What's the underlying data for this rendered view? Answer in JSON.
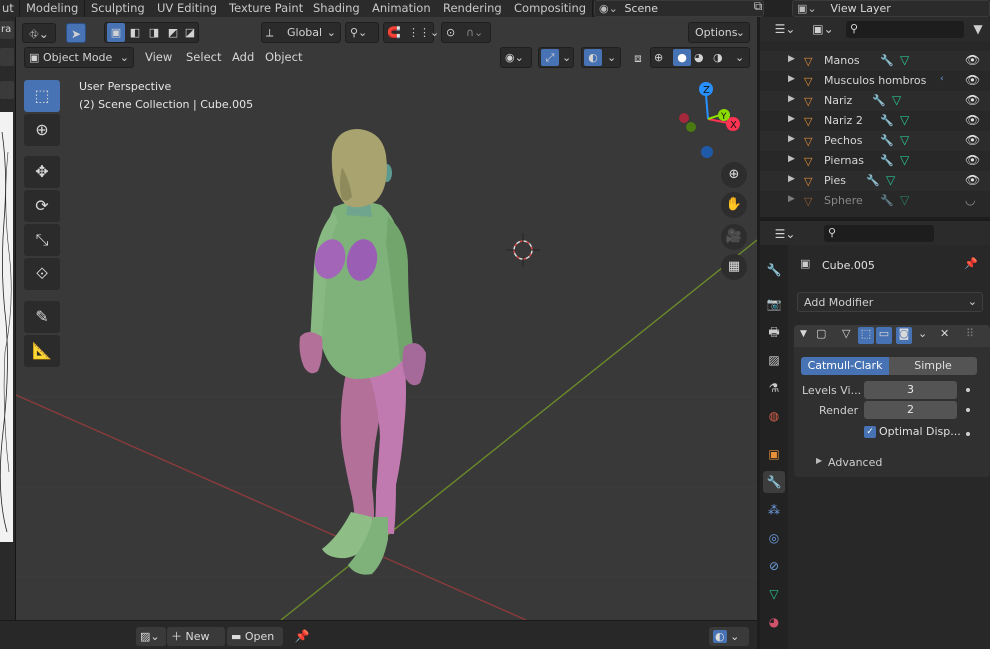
{
  "workspace_tabs": [
    {
      "label": "ut",
      "active": false
    },
    {
      "label": "Modeling",
      "active": false
    },
    {
      "label": "Sculpting",
      "active": false
    },
    {
      "label": "UV Editing",
      "active": false
    },
    {
      "label": "Texture Paint",
      "active": false
    },
    {
      "label": "Shading",
      "active": false
    },
    {
      "label": "Animation",
      "active": false
    },
    {
      "label": "Rendering",
      "active": false
    },
    {
      "label": "Compositing",
      "active": false
    }
  ],
  "scene_name": "Scene",
  "view_layer_name": "View Layer",
  "left_strip": {
    "partial_label": "ra"
  },
  "viewport": {
    "header_row1": {
      "transform_orientation": "Global",
      "options_label": "Options"
    },
    "header_row2": {
      "mode": "Object Mode",
      "menus": [
        "View",
        "Select",
        "Add",
        "Object"
      ]
    },
    "overlay": {
      "view_name": "User Perspective",
      "collection_path": "(2) Scene Collection | Cube.005"
    },
    "gizmo_axes": {
      "x": "X",
      "y": "Y",
      "z": "Z"
    }
  },
  "bottom_bar": {
    "new_label": "New",
    "open_label": "Open"
  },
  "outliner": {
    "rows": [
      {
        "name": "Manos",
        "dimmed": false
      },
      {
        "name": "Musculos hombros",
        "dimmed": false
      },
      {
        "name": "Nariz",
        "dimmed": false
      },
      {
        "name": "Nariz 2",
        "dimmed": false
      },
      {
        "name": "Pechos",
        "dimmed": false
      },
      {
        "name": "Piernas",
        "dimmed": false
      },
      {
        "name": "Pies",
        "dimmed": false
      },
      {
        "name": "Sphere",
        "dimmed": true
      }
    ]
  },
  "properties": {
    "object_name": "Cube.005",
    "add_modifier_label": "Add Modifier",
    "subdiv_types": [
      "Catmull-Clark",
      "Simple"
    ],
    "active_subdiv_type": "Catmull-Clark",
    "levels_viewport_label": "Levels Vi...",
    "levels_viewport_value": "3",
    "render_label": "Render",
    "render_value": "2",
    "optimal_display_label": "Optimal Disp...",
    "optimal_display_checked": true,
    "advanced_label": "Advanced"
  },
  "colors": {
    "accent_blue": "#4772b3",
    "outliner_object": "#e8913a",
    "modifier_blue": "#6fa0e6",
    "mesh_green": "#27c495",
    "axis_x": "#ff3352",
    "axis_y": "#8bdc00",
    "axis_z": "#2890ff",
    "figure_green": "#7fb27a",
    "figure_pink": "#c17ab0",
    "figure_purple": "#9a5fb5",
    "figure_head": "#a9a36f"
  }
}
